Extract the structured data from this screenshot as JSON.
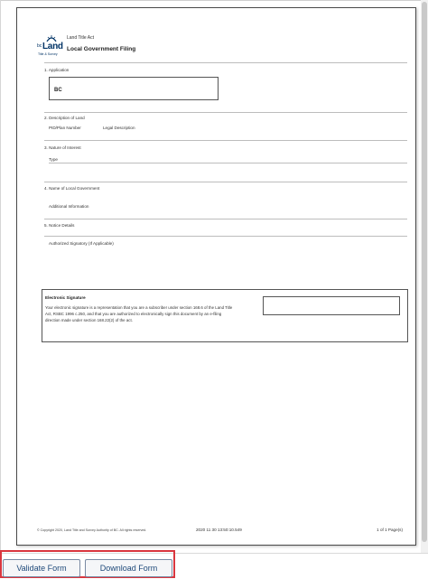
{
  "form": {
    "act_label": "Land Title Act",
    "title": "Local Government Filing",
    "logo": {
      "bc": "bc",
      "land": "Land",
      "sub": "Title & Survey"
    },
    "sections": {
      "application": {
        "label": "1. Application",
        "value": "BC"
      },
      "description": {
        "label": "2. Description of Land",
        "pid_label": "PID/Plan Number",
        "legal_label": "Legal Description"
      },
      "interest": {
        "label": "3. Nature of Interest",
        "type_label": "Type"
      },
      "government": {
        "label": "4. Name of Local Government",
        "additional_label": "Additional Information"
      },
      "notice": {
        "label": "5. Notice Details",
        "signatory_label": "Authorized Signatory (If Applicable)"
      }
    },
    "esig": {
      "title": "Electronic Signature",
      "body": "Your electronic signature is a representation that you are a subscriber under section 168.6 of the Land Title Act, RSBC 1996 c.250, and that you are authorized to electronically sign this document by an e-filing direction made under section 168.22(2) of the act."
    },
    "footer": {
      "copyright": "© Copyright 2020, Land Title and Survey Authority of BC. All rights reserved.",
      "timestamp": "2020 11 30 13:50:10.549",
      "page": "1 of 1 Page(s)"
    }
  },
  "actions": {
    "validate_label": "Validate Form",
    "download_label": "Download Form",
    "highlight_color": "#d9363e"
  }
}
